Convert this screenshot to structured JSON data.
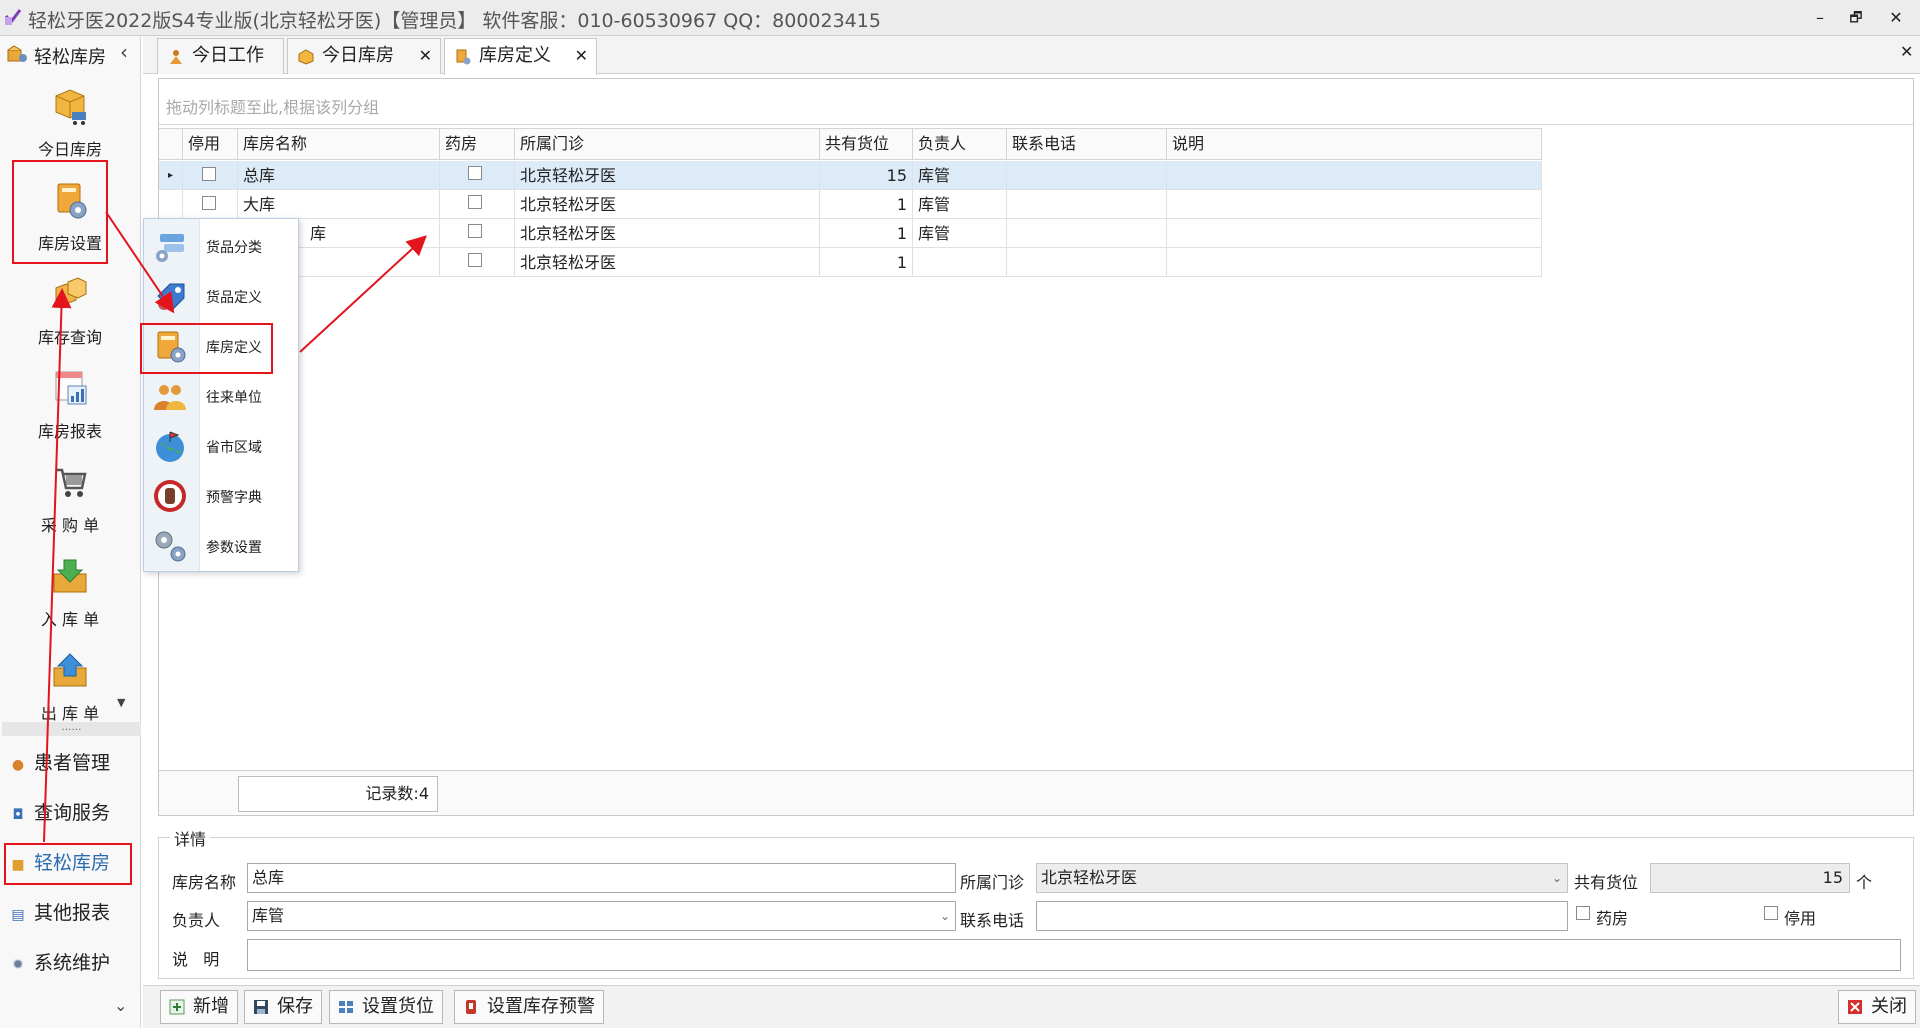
{
  "window": {
    "title": "轻松牙医2022版S4专业版(北京轻松牙医)【管理员】   软件客服：010-60530967 QQ：800023415",
    "minimize": "–",
    "restore": "🗗",
    "close": "✕"
  },
  "sidebar": {
    "header": "轻松库房",
    "collapse": "‹",
    "big_items": [
      {
        "label": "今日库房",
        "icon": "cart-box-icon"
      },
      {
        "label": "库房设置",
        "icon": "warehouse-gear-icon"
      },
      {
        "label": "库存查询",
        "icon": "boxes-icon"
      },
      {
        "label": "库房报表",
        "icon": "report-chart-icon"
      },
      {
        "label": "采 购 单",
        "icon": "shopping-cart-icon"
      },
      {
        "label": "入 库 单",
        "icon": "inbox-in-icon"
      },
      {
        "label": "出 库 单",
        "icon": "inbox-out-icon"
      }
    ],
    "more_arrow": "▼",
    "splitter": "……",
    "modules": [
      {
        "label": "患者管理",
        "icon": "patients-icon"
      },
      {
        "label": "查询服务",
        "icon": "query-icon"
      },
      {
        "label": "轻松库房",
        "icon": "warehouse-icon"
      },
      {
        "label": "其他报表",
        "icon": "reports-icon"
      },
      {
        "label": "系统维护",
        "icon": "settings-icon"
      }
    ],
    "bottom_arrow": "⌄"
  },
  "tabs": [
    {
      "label": "今日工作",
      "closable": false
    },
    {
      "label": "今日库房",
      "closable": true
    },
    {
      "label": "库房定义",
      "closable": true,
      "active": true
    }
  ],
  "tab_close": "✕",
  "tabs_close_all": "✕",
  "grid": {
    "group_hint": "拖动列标题至此,根据该列分组",
    "columns": [
      "停用",
      "库房名称",
      "药房",
      "所属门诊",
      "共有货位",
      "负责人",
      "联系电话",
      "说明"
    ],
    "rows": [
      {
        "disabled": false,
        "name": "总库",
        "pharmacy": false,
        "clinic": "北京轻松牙医",
        "slots": "15",
        "manager": "库管",
        "phone": "",
        "note": ""
      },
      {
        "disabled": false,
        "name": "大库",
        "pharmacy": false,
        "clinic": "北京轻松牙医",
        "slots": "1",
        "manager": "库管",
        "phone": "",
        "note": ""
      },
      {
        "disabled": false,
        "name": "库",
        "pharmacy": false,
        "clinic": "北京轻松牙医",
        "slots": "1",
        "manager": "库管",
        "phone": "",
        "note": ""
      },
      {
        "disabled": false,
        "name": "",
        "pharmacy": false,
        "clinic": "北京轻松牙医",
        "slots": "1",
        "manager": "",
        "phone": "",
        "note": ""
      }
    ],
    "record_count": "记录数:4",
    "row_indicator": "▸"
  },
  "details": {
    "title": "详情",
    "name_label": "库房名称",
    "name_value": "总库",
    "clinic_label": "所属门诊",
    "clinic_value": "北京轻松牙医",
    "slots_label": "共有货位",
    "slots_value": "15",
    "slots_unit": "个",
    "manager_label": "负责人",
    "manager_value": "库管",
    "phone_label": "联系电话",
    "phone_value": "",
    "pharmacy_label": "药房",
    "disabled_label": "停用",
    "note_label": "说   明",
    "note_value": ""
  },
  "toolbar": {
    "add": "新增",
    "save": "保存",
    "set_slots": "设置货位",
    "set_alert": "设置库存预警",
    "close": "关闭"
  },
  "popup_menu": [
    {
      "label": "货品分类",
      "icon": "category-gear-icon"
    },
    {
      "label": "货品定义",
      "icon": "tag-gear-icon"
    },
    {
      "label": "库房定义",
      "icon": "warehouse-gear-icon"
    },
    {
      "label": "往来单位",
      "icon": "partners-icon"
    },
    {
      "label": "省市区域",
      "icon": "globe-flag-icon"
    },
    {
      "label": "预警字典",
      "icon": "stop-hand-icon"
    },
    {
      "label": "参数设置",
      "icon": "gears-icon"
    }
  ],
  "colors": {
    "annotation_red": "#e3141e",
    "selected_row": "#dcebf7",
    "accent_blue": "#2b6cb0"
  }
}
